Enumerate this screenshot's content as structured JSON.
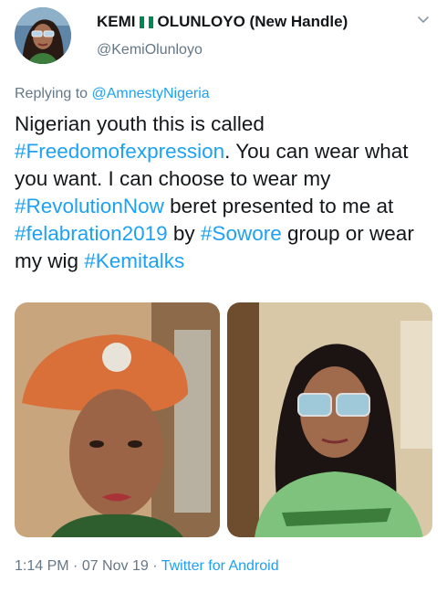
{
  "author": {
    "name_part1": "KEMI",
    "name_part2": "OLUNLOYO (New Handle)",
    "handle": "@KemiOlunloyo"
  },
  "reply": {
    "prefix": "Replying to ",
    "mention": "@AmnestyNigeria"
  },
  "tweet": {
    "t1": "Nigerian youth this is called ",
    "h1": "#Freedomofexpression",
    "t2": ". You can wear what you want. I can choose to wear my ",
    "h2": "#RevolutionNow",
    "t3": " beret presented to me at ",
    "h3": "#felabration2019",
    "t4": " by ",
    "h4": "#Sowore",
    "t5": " group or wear my wig ",
    "h5": "#Kemitalks"
  },
  "meta": {
    "time": "1:14 PM",
    "sep1": " · ",
    "date": "07 Nov 19",
    "sep2": " · ",
    "app": "Twitter for Android"
  },
  "colors": {
    "link": "#1da1f2",
    "secondary": "#657786",
    "flag_green": "#008751"
  },
  "icons": {
    "menu": "chevron-down-icon",
    "flag": "nigeria-flag-icon"
  }
}
